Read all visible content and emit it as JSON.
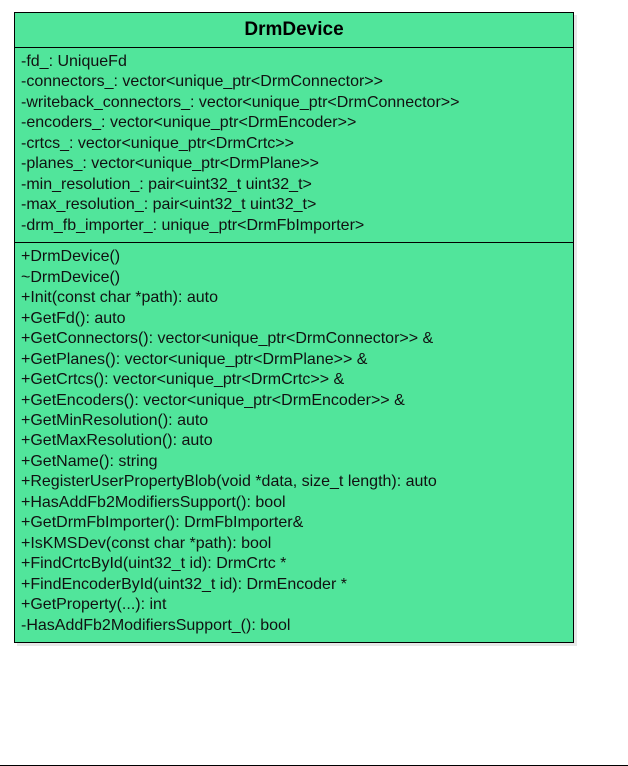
{
  "class": {
    "name": "DrmDevice",
    "attributes": [
      "-fd_: UniqueFd",
      "-connectors_: vector<unique_ptr<DrmConnector>>",
      "-writeback_connectors_: vector<unique_ptr<DrmConnector>>",
      "-encoders_: vector<unique_ptr<DrmEncoder>>",
      "-crtcs_: vector<unique_ptr<DrmCrtc>>",
      "-planes_: vector<unique_ptr<DrmPlane>>",
      "-min_resolution_: pair<uint32_t  uint32_t>",
      "-max_resolution_: pair<uint32_t  uint32_t>",
      "-drm_fb_importer_: unique_ptr<DrmFbImporter>"
    ],
    "operations": [
      "+DrmDevice()",
      "~DrmDevice()",
      "+Init(const char *path): auto",
      "+GetFd(): auto",
      "+GetConnectors(): vector<unique_ptr<DrmConnector>> &",
      "+GetPlanes(): vector<unique_ptr<DrmPlane>> &",
      "+GetCrtcs(): vector<unique_ptr<DrmCrtc>> &",
      "+GetEncoders(): vector<unique_ptr<DrmEncoder>> &",
      "+GetMinResolution(): auto",
      "+GetMaxResolution(): auto",
      "+GetName(): string",
      "+RegisterUserPropertyBlob(void *data, size_t length): auto",
      "+HasAddFb2ModifiersSupport(): bool",
      "+GetDrmFbImporter(): DrmFbImporter&",
      "+IsKMSDev(const char *path): bool",
      "+FindCrtcById(uint32_t id): DrmCrtc *",
      "+FindEncoderById(uint32_t id): DrmEncoder *",
      "+GetProperty(...): int",
      "-HasAddFb2ModifiersSupport_(): bool"
    ]
  }
}
